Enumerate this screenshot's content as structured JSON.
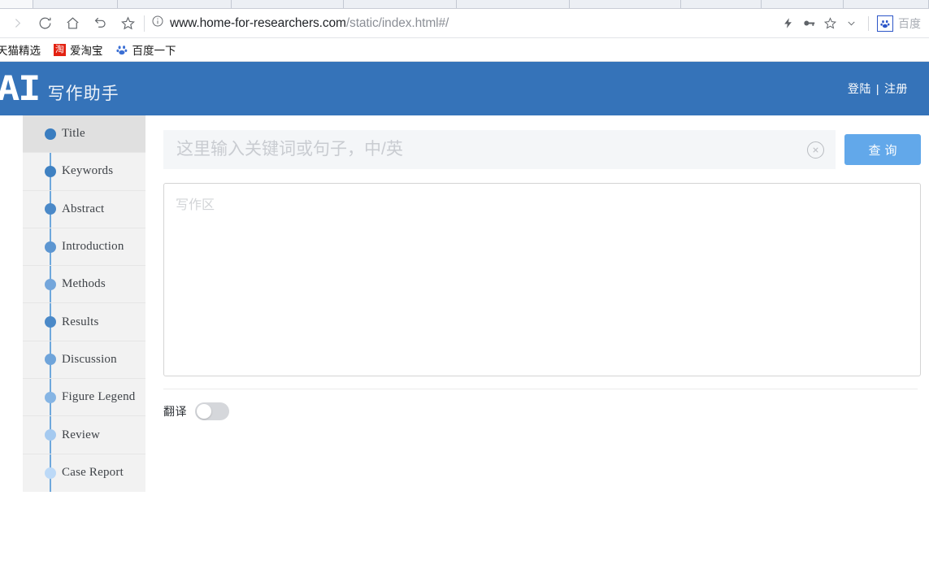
{
  "browser": {
    "nav_icons": [
      {
        "name": "forward-icon",
        "glyph": "forward"
      },
      {
        "name": "reload-icon",
        "glyph": "reload"
      },
      {
        "name": "home-icon",
        "glyph": "home"
      },
      {
        "name": "back-icon",
        "glyph": "undo"
      },
      {
        "name": "bookmark-star-icon",
        "glyph": "star"
      }
    ],
    "url": {
      "domain": "www.home-for-researchers.com",
      "path": "/static/index.html#/",
      "security_icon": "info-circle-icon"
    },
    "toolbar_right_icons": [
      {
        "name": "lightning-icon",
        "glyph": "⚡"
      },
      {
        "name": "key-icon",
        "glyph": "key"
      },
      {
        "name": "star-outline-icon",
        "glyph": "star"
      },
      {
        "name": "chevron-down-icon",
        "glyph": "chevron"
      }
    ],
    "search_engine": {
      "icon_name": "baidu-paw-icon",
      "label": "百度"
    },
    "bookmarks": [
      {
        "label": "天猫精选",
        "icon": "none"
      },
      {
        "label": "爱淘宝",
        "icon": "taobao-icon",
        "icon_char": "淘",
        "icon_color": "#e32212"
      },
      {
        "label": "百度一下",
        "icon": "baidu-paw-icon"
      }
    ]
  },
  "header": {
    "logo_text": "AI",
    "logo_subtitle": "写作助手",
    "auth": {
      "login": "登陆",
      "divider": "|",
      "register": "注册"
    },
    "background_color": "#3573b9"
  },
  "sidebar": {
    "items": [
      {
        "label": "Title",
        "active": true
      },
      {
        "label": "Keywords",
        "active": false
      },
      {
        "label": "Abstract",
        "active": false
      },
      {
        "label": "Introduction",
        "active": false
      },
      {
        "label": "Methods",
        "active": false
      },
      {
        "label": "Results",
        "active": false
      },
      {
        "label": "Discussion",
        "active": false
      },
      {
        "label": "Figure Legend",
        "active": false
      },
      {
        "label": "Review",
        "active": false
      },
      {
        "label": "Case Report",
        "active": false
      }
    ],
    "dot_colors": [
      "#3a7dc0",
      "#3f81c2",
      "#4b89c8",
      "#5d96d1",
      "#74a6db",
      "#4b89c8",
      "#6fa4da",
      "#86b5e4",
      "#a5caf0",
      "#bcd9f7"
    ]
  },
  "main": {
    "search": {
      "value": "",
      "placeholder": "这里输入关键词或句子，中/英",
      "clear_icon": "clear-circle-icon",
      "button_label": "查询",
      "button_color": "#62a8ea"
    },
    "editor": {
      "value": "",
      "placeholder": "写作区"
    },
    "translate": {
      "label": "翻译",
      "state": "off"
    }
  }
}
